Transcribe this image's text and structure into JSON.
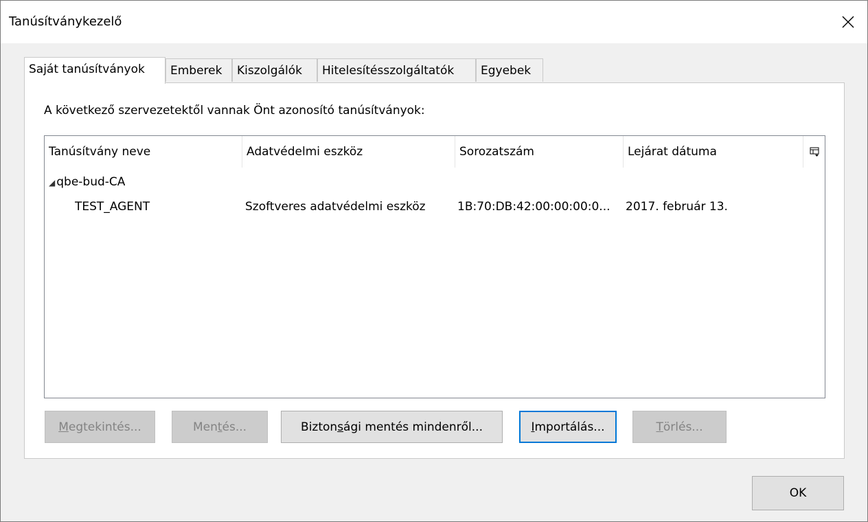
{
  "window": {
    "title": "Tanúsítványkezelő"
  },
  "tabs": [
    {
      "label": "Saját tanúsítványok",
      "active": true
    },
    {
      "label": "Emberek",
      "active": false
    },
    {
      "label": "Kiszolgálók",
      "active": false
    },
    {
      "label": "Hitelesítésszolgáltatók",
      "active": false
    },
    {
      "label": "Egyebek",
      "active": false
    }
  ],
  "description": "A következő szervezetektől vannak Önt azonosító tanúsítványok:",
  "columns": [
    "Tanúsítvány neve",
    "Adatvédelmi eszköz",
    "Sorozatszám",
    "Lejárat dátuma"
  ],
  "tree": {
    "group": {
      "label": "qbe-bud-CA",
      "expanded": true
    },
    "rows": [
      {
        "name": "TEST_AGENT",
        "device": "Szoftveres adatvédelmi eszköz",
        "serial": "1B:70:DB:42:00:00:00:0...",
        "expiry": "2017. február 13."
      }
    ]
  },
  "buttons": {
    "view": {
      "pre": "",
      "key": "M",
      "post": "egtekintés...",
      "enabled": false
    },
    "backup": {
      "pre": "Men",
      "key": "t",
      "post": "és...",
      "enabled": false
    },
    "backup_all": {
      "pre": "Bizton",
      "key": "s",
      "post": "ági mentés mindenről...",
      "enabled": true
    },
    "import": {
      "pre": "",
      "key": "I",
      "post": "mportálás...",
      "enabled": true,
      "focused": true
    },
    "delete": {
      "pre": "",
      "key": "T",
      "post": "örlés...",
      "enabled": false
    }
  },
  "ok_label": "OK",
  "colors": {
    "focus_border": "#0078d7",
    "window_bg": "#f0f0f0",
    "disabled_text": "#838383"
  }
}
